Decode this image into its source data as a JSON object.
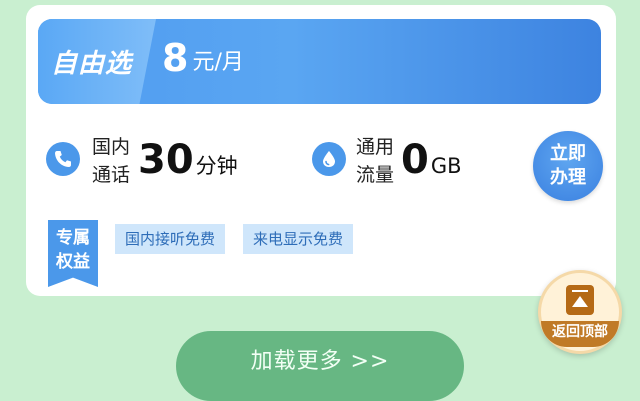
{
  "plan": {
    "name": "自由选",
    "price": "8",
    "unit": "元/月"
  },
  "features": {
    "call": {
      "label_line1": "国内",
      "label_line2": "通话",
      "value": "30",
      "unit": "分钟",
      "icon": "phone-icon"
    },
    "data": {
      "label_line1": "通用",
      "label_line2": "流量",
      "value": "0",
      "unit": "GB",
      "icon": "water-drop-icon"
    }
  },
  "apply_button": {
    "line1": "立即",
    "line2": "办理"
  },
  "perks": {
    "badge_line1": "专属",
    "badge_line2": "权益",
    "tags": [
      "国内接听免费",
      "来电显示免费"
    ]
  },
  "back_to_top": {
    "label": "返回顶部"
  },
  "load_more": {
    "label": "加载更多 >>"
  },
  "colors": {
    "background": "#c9efd0",
    "accent_blue": "#4b98ea",
    "load_more_green": "#67b783",
    "back_to_top_brown": "#c07a27"
  }
}
